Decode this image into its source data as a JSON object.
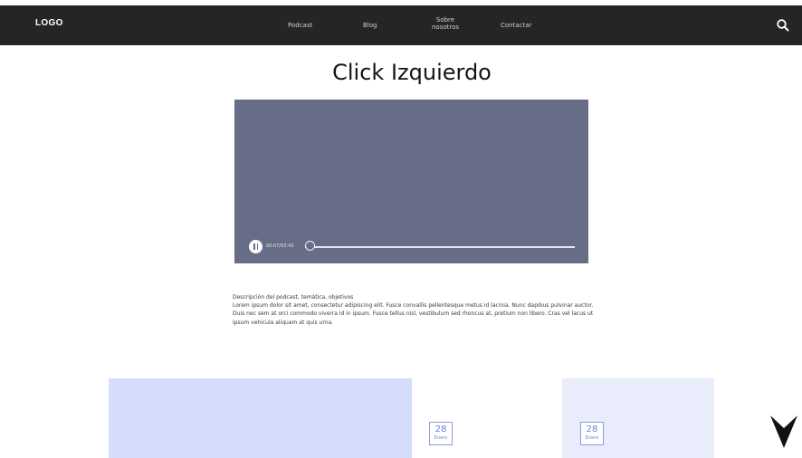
{
  "header": {
    "logo": "LOGO",
    "nav": [
      {
        "label": "Podcast"
      },
      {
        "label": "Blog"
      },
      {
        "label_line1": "Sobre",
        "label_line2": "nosotros"
      },
      {
        "label": "Contactar"
      }
    ],
    "search_icon": "search-icon"
  },
  "page": {
    "title": "Click Izquierdo"
  },
  "player": {
    "time": "00:07/03:43",
    "progress": 0.02,
    "colors": {
      "background": "#676d87"
    }
  },
  "description": {
    "heading": "Descripción del podcast, temática, objetivos",
    "body": "Lorem ipsum dolor sit amet, consectetur adipiscing elit. Fusce convallis pellentesque metus id lacinia. Nunc dapibus pulvinar auctor. Duis nec sem at orci commodo viverra id in ipsum. Fusce tellus nisl, vestibulum sed rhoncus at, pretium non libero. Cras vel lacus ut ipsum vehicula aliquam at quis urna."
  },
  "episodes": [
    {
      "day": "28",
      "month": "Enero"
    },
    {
      "day": "28",
      "month": "Enero"
    }
  ],
  "scroll": {
    "icon": "arrow-down-icon"
  }
}
